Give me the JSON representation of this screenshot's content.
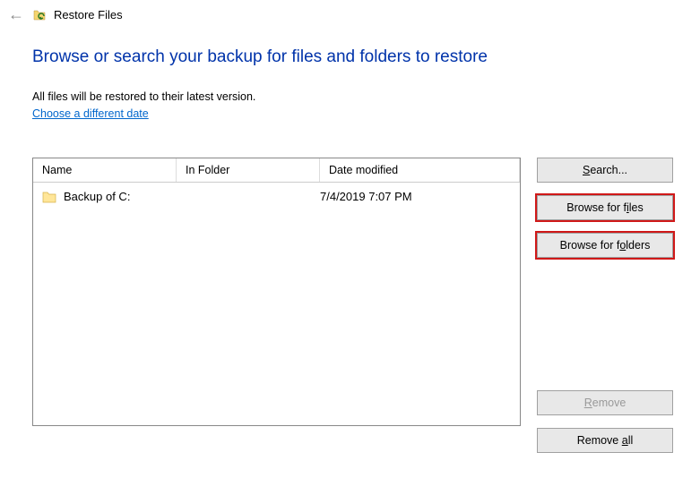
{
  "window": {
    "title": "Restore Files"
  },
  "page": {
    "heading": "Browse or search your backup for files and folders to restore",
    "subtext": "All files will be restored to their latest version.",
    "link_choose_date": "Choose a different date"
  },
  "grid": {
    "headers": {
      "name": "Name",
      "folder": "In Folder",
      "date": "Date modified"
    },
    "rows": [
      {
        "name": "Backup of C:",
        "folder": "",
        "date": "7/4/2019 7:07 PM"
      }
    ]
  },
  "buttons": {
    "search": "Search...",
    "browse_files": "Browse for files",
    "browse_folders": "Browse for folders",
    "remove": "Remove",
    "remove_all": "Remove all"
  }
}
